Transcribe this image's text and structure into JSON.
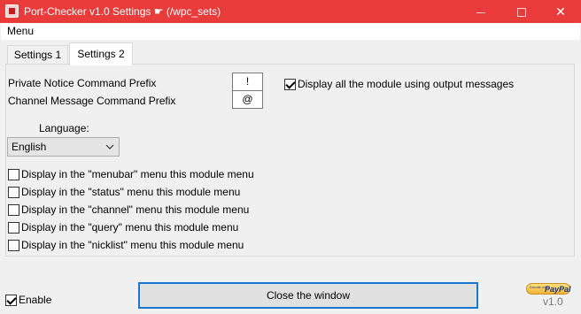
{
  "window": {
    "title": "Port-Checker v1.0 Settings ☛ (/wpc_sets)",
    "minimize_icon": "minimize-icon",
    "maximize_icon": "maximize-icon",
    "close_label": "✕"
  },
  "menubar": {
    "menu_label": "Menu"
  },
  "tabs": [
    {
      "label": "Settings 1",
      "active": false
    },
    {
      "label": "Settings 2",
      "active": true
    }
  ],
  "settings": {
    "private_notice_label": "Private Notice Command Prefix",
    "private_notice_value": "!",
    "channel_message_label": "Channel Message Command Prefix",
    "channel_message_value": "@",
    "display_output_label": "Display all the module using output messages",
    "display_output_checked": true,
    "language_label": "Language:",
    "language_value": "English",
    "menus": [
      {
        "label": "Display in the \"menubar\" menu this module menu",
        "checked": false
      },
      {
        "label": "Display in the \"status\" menu this module menu",
        "checked": false
      },
      {
        "label": "Display in the \"channel\" menu this module menu",
        "checked": false
      },
      {
        "label": "Display in the \"query\" menu this module menu",
        "checked": false
      },
      {
        "label": "Display in the \"nicklist\" menu this module menu",
        "checked": false
      }
    ]
  },
  "footer": {
    "enable_label": "Enable",
    "enable_checked": true,
    "close_button_label": "Close the window",
    "paypal_donate": "Donate with",
    "paypal_brand": "PayPal",
    "version": "v1.0"
  },
  "colors": {
    "titlebar": "#ea3b3b",
    "focus_border": "#1976d2"
  }
}
